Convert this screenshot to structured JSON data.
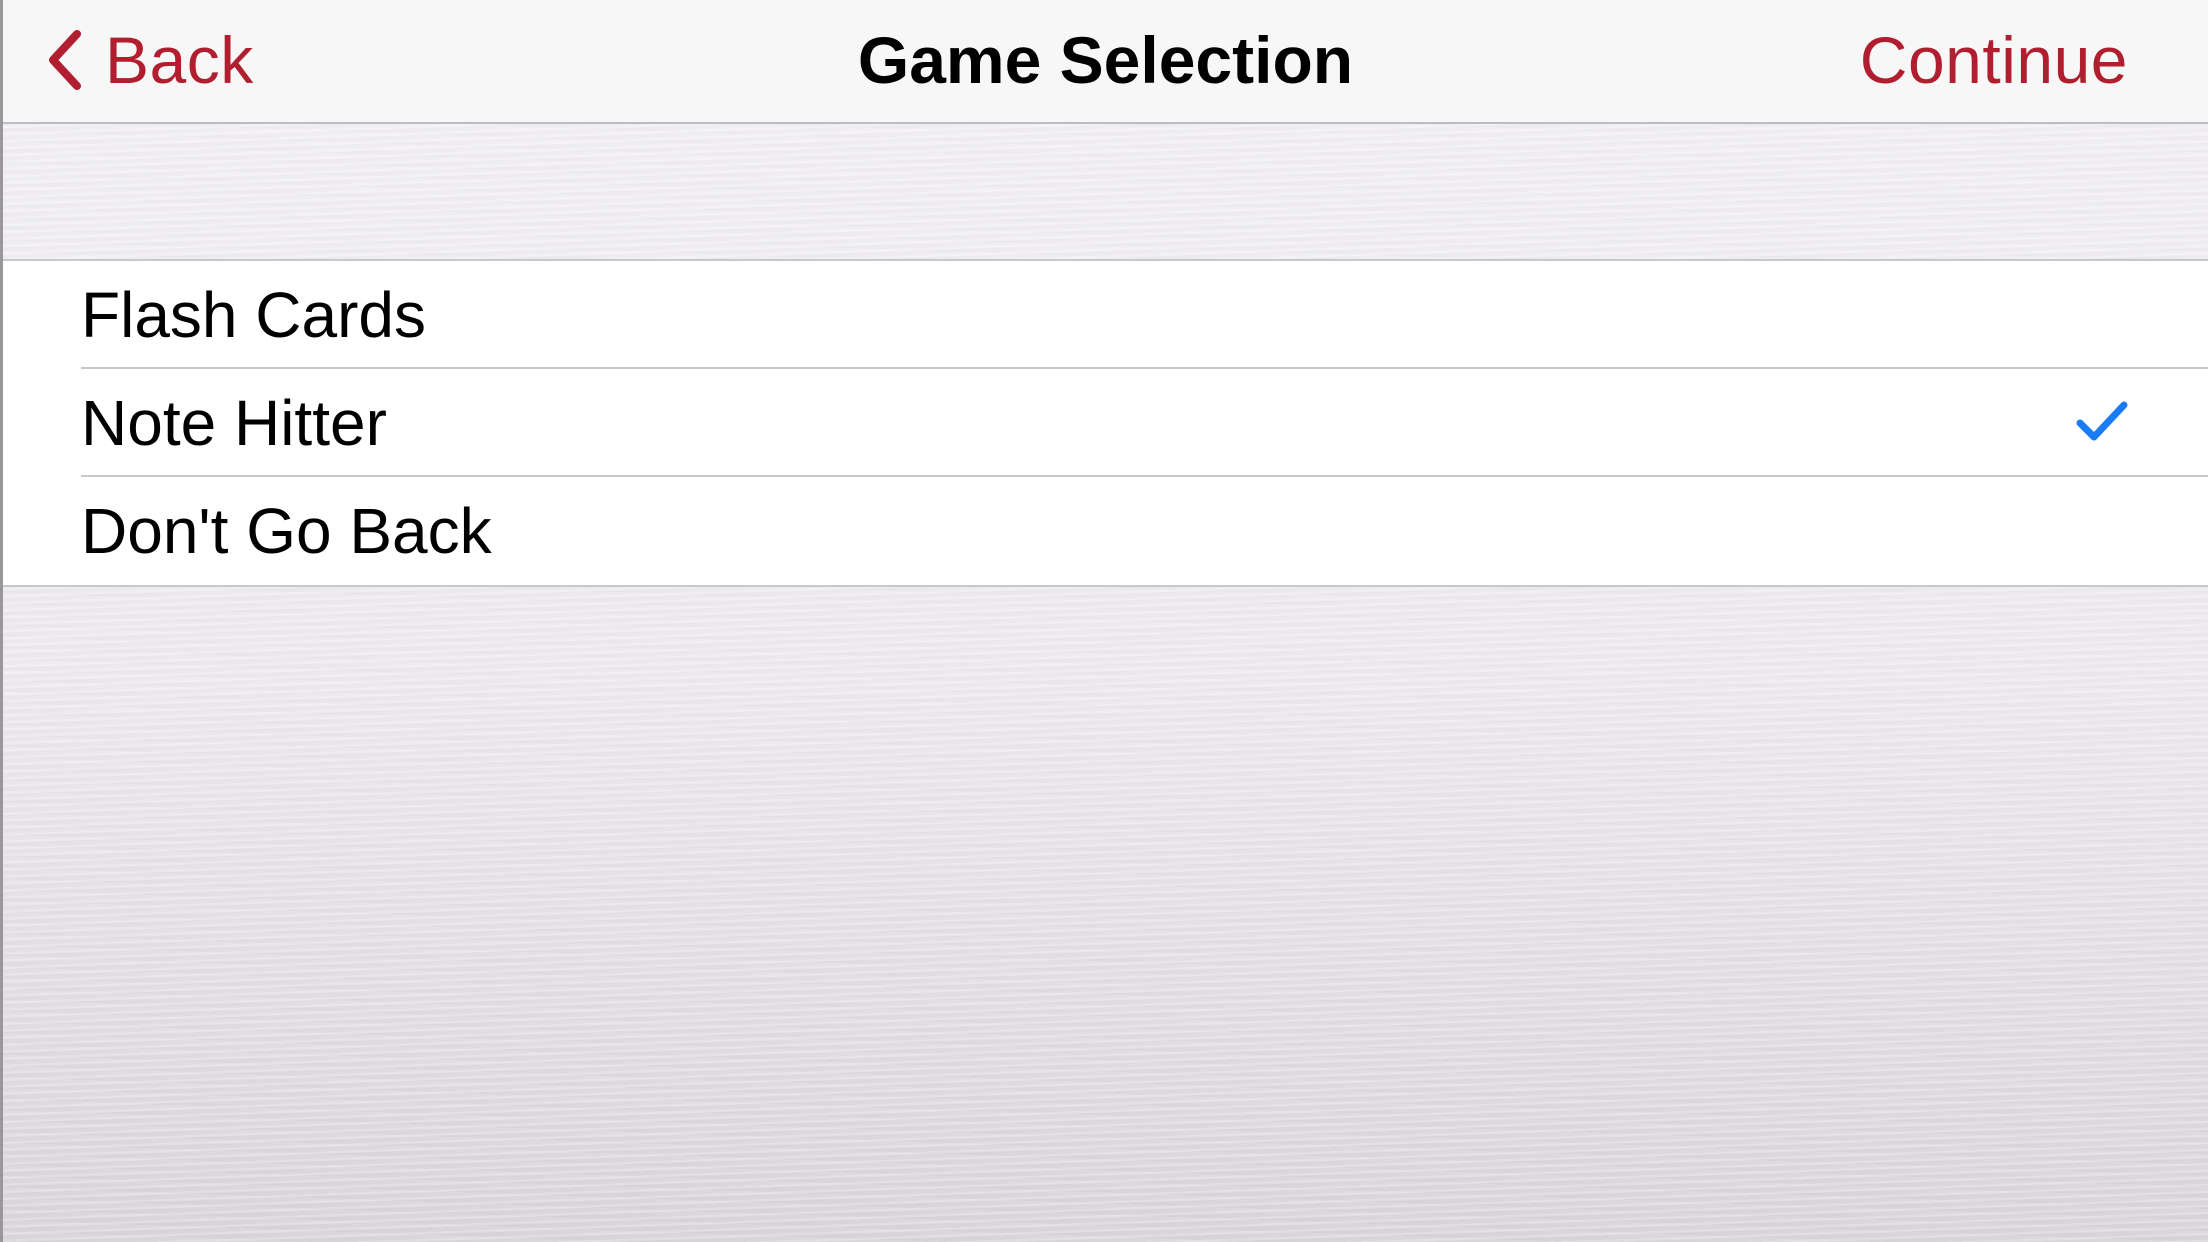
{
  "navbar": {
    "back_label": "Back",
    "title": "Game Selection",
    "continue_label": "Continue",
    "tint_color": "#b01e2f"
  },
  "games": [
    {
      "label": "Flash Cards",
      "selected": false
    },
    {
      "label": "Note Hitter",
      "selected": true
    },
    {
      "label": "Don't Go Back",
      "selected": false
    }
  ],
  "icons": {
    "back": "chevron-left-icon",
    "selected": "checkmark-icon"
  },
  "colors": {
    "checkmark": "#1a7cf5",
    "title": "#000000"
  }
}
